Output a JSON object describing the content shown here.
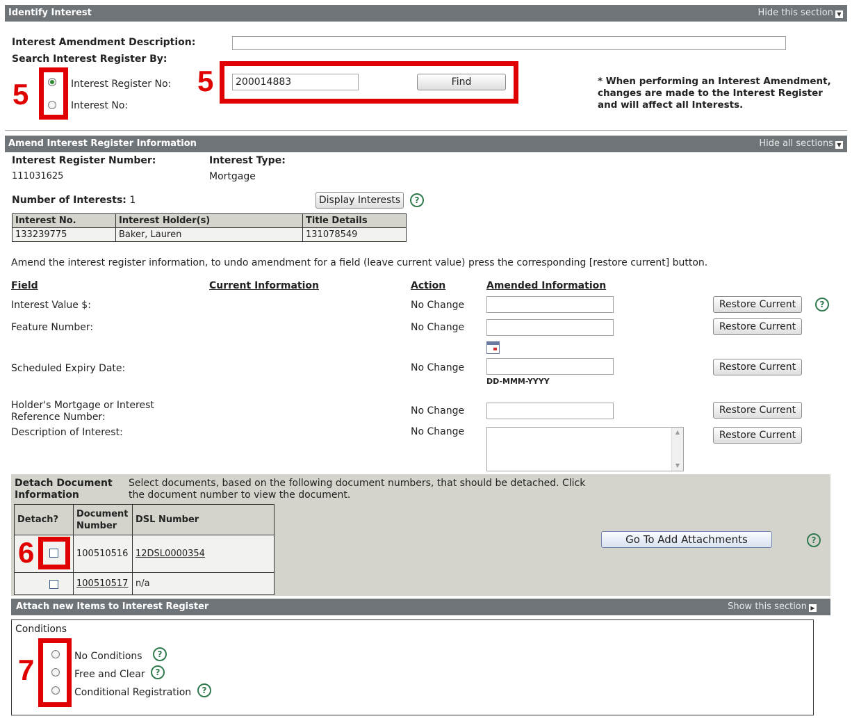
{
  "identify": {
    "title": "Identify Interest",
    "hide_label": "Hide this section",
    "amend_desc_label": "Interest Amendment Description:",
    "search_by_label": "Search Interest Register By:",
    "radio_register_label": "Interest Register No:",
    "radio_interest_label": "Interest No:",
    "register_value": "200014883",
    "find_label": "Find",
    "note": "* When performing an Interest Amendment, changes are made to the Interest Register and will affect all Interests.",
    "marker_left": "5",
    "marker_right": "5"
  },
  "amend": {
    "title": "Amend Interest Register Information",
    "hide_label": "Hide all sections",
    "reg_num_label": "Interest Register Number:",
    "reg_num_value": "111031625",
    "type_label": "Interest Type:",
    "type_value": "Mortgage",
    "num_interests_label": "Number of Interests:",
    "num_interests_value": "1",
    "display_button": "Display Interests",
    "interest_table": {
      "headers": [
        "Interest No.",
        "Interest Holder(s)",
        "Title Details"
      ],
      "rows": [
        [
          "133239775",
          "Baker, Lauren",
          "131078549"
        ]
      ]
    },
    "instructions": "Amend the interest register information, to undo amendment for a field (leave current value) press the corresponding [restore current] button.",
    "col_field": "Field",
    "col_current": "Current Information",
    "col_action": "Action",
    "col_amended": "Amended Information",
    "fields": [
      {
        "label": "Interest Value $:",
        "action": "No Change"
      },
      {
        "label": "Feature Number:",
        "action": "No Change"
      },
      {
        "label": "Scheduled Expiry Date:",
        "action": "No Change"
      },
      {
        "label": "Holder's Mortgage or Interest Reference Number:",
        "action": "No Change"
      },
      {
        "label": "Description of Interest:",
        "action": "No Change"
      }
    ],
    "date_hint": "DD-MMM-YYYY",
    "restore_label": "Restore Current"
  },
  "detach": {
    "title": "Detach Document Information",
    "desc": "Select documents, based on the following document numbers, that should be detached. Click the document number to view the document.",
    "headers": [
      "Detach?",
      "Document Number",
      "DSL Number"
    ],
    "rows": [
      [
        "100510516",
        "12DSL0000354"
      ],
      [
        "100510517",
        "n/a"
      ]
    ],
    "go_button": "Go To Add Attachments",
    "marker": "6"
  },
  "attach": {
    "title": "Attach new Items to Interest Register",
    "show_label": "Show this section",
    "conditions_label": "Conditions",
    "options": [
      "No Conditions",
      "Free and Clear",
      "Conditional Registration"
    ],
    "marker": "7"
  },
  "colors": {
    "header_bar": "#6e7478",
    "marker_red": "#e00000",
    "help_green": "#2f7a4e",
    "detach_bg": "#d4d4cc"
  }
}
